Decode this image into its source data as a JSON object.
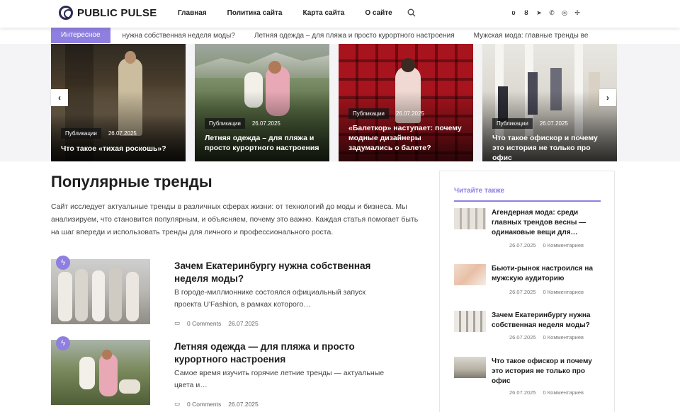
{
  "brand": {
    "name": "PUBLIC PULSE"
  },
  "nav": {
    "items": [
      "Главная",
      "Политика сайта",
      "Карта сайта",
      "О сайте"
    ]
  },
  "socials": [
    "vk-icon",
    "odnoklassniki-icon",
    "telegram-icon",
    "phone-icon",
    "whatsapp-icon",
    "zen-icon"
  ],
  "ticker": {
    "label": "Интересное",
    "items": [
      "нужна собственная неделя моды?",
      "Летняя одежда – для пляжа и просто курортного настроения",
      "Мужская мода: главные тренды ве"
    ]
  },
  "slider": {
    "prev_icon": "‹",
    "next_icon": "›",
    "slides": [
      {
        "tag": "Публикации",
        "date": "26.07.2025",
        "title": "Что такое «тихая роскошь»?"
      },
      {
        "tag": "Публикации",
        "date": "26.07.2025",
        "title": "Летняя одежда – для пляжа и просто курортного настроения"
      },
      {
        "tag": "Публикации",
        "date": "26.07.2025",
        "title": "«Балеткор» наступает: почему модные дизайнеры задумались о балете?"
      },
      {
        "tag": "Публикации",
        "date": "26.07.2025",
        "title": "Что такое офискор и почему это история не только про офис"
      }
    ]
  },
  "main": {
    "title": "Популярные тренды",
    "description": "Сайт исследует актуальные тренды в различных сферах жизни: от технологий до моды и бизнеса. Мы анализируем, что становится популярным, и объясняем, почему это важно. Каждая статья помогает быть на шаг впереди и использовать тренды для личного и профессионального роста.",
    "articles": [
      {
        "title": "Зачем Екатеринбургу нужна собственная неделя моды?",
        "excerpt": "В городе-миллионнике состоялся официальный запуск проекта U'Fashion, в рамках которого…",
        "comments": "0 Comments",
        "date": "26.07.2025"
      },
      {
        "title": "Летняя одежда — для пляжа и просто курортного настроения",
        "excerpt": "Самое время изучить горячие летние тренды — актуальные цвета и…",
        "comments": "0 Comments",
        "date": "26.07.2025"
      }
    ]
  },
  "sidebar": {
    "title": "Читайте также",
    "items": [
      {
        "title": "Агендерная мода: среди главных трендов весны — одинаковые вещи для…",
        "date": "26.07.2025",
        "comments": "0 Комментариев"
      },
      {
        "title": "Бьюти-рынок настроился на мужскую аудиторию",
        "date": "26.07.2025",
        "comments": "0 Комментариев"
      },
      {
        "title": "Зачем Екатеринбургу нужна собственная неделя моды?",
        "date": "26.07.2025",
        "comments": "0 Комментариев"
      },
      {
        "title": "Что такое офискор и почему это история не только про офис",
        "date": "26.07.2025",
        "comments": "0 Комментариев"
      }
    ]
  },
  "colors": {
    "accent": "#8f7fe0",
    "text": "#1d1d1d"
  }
}
